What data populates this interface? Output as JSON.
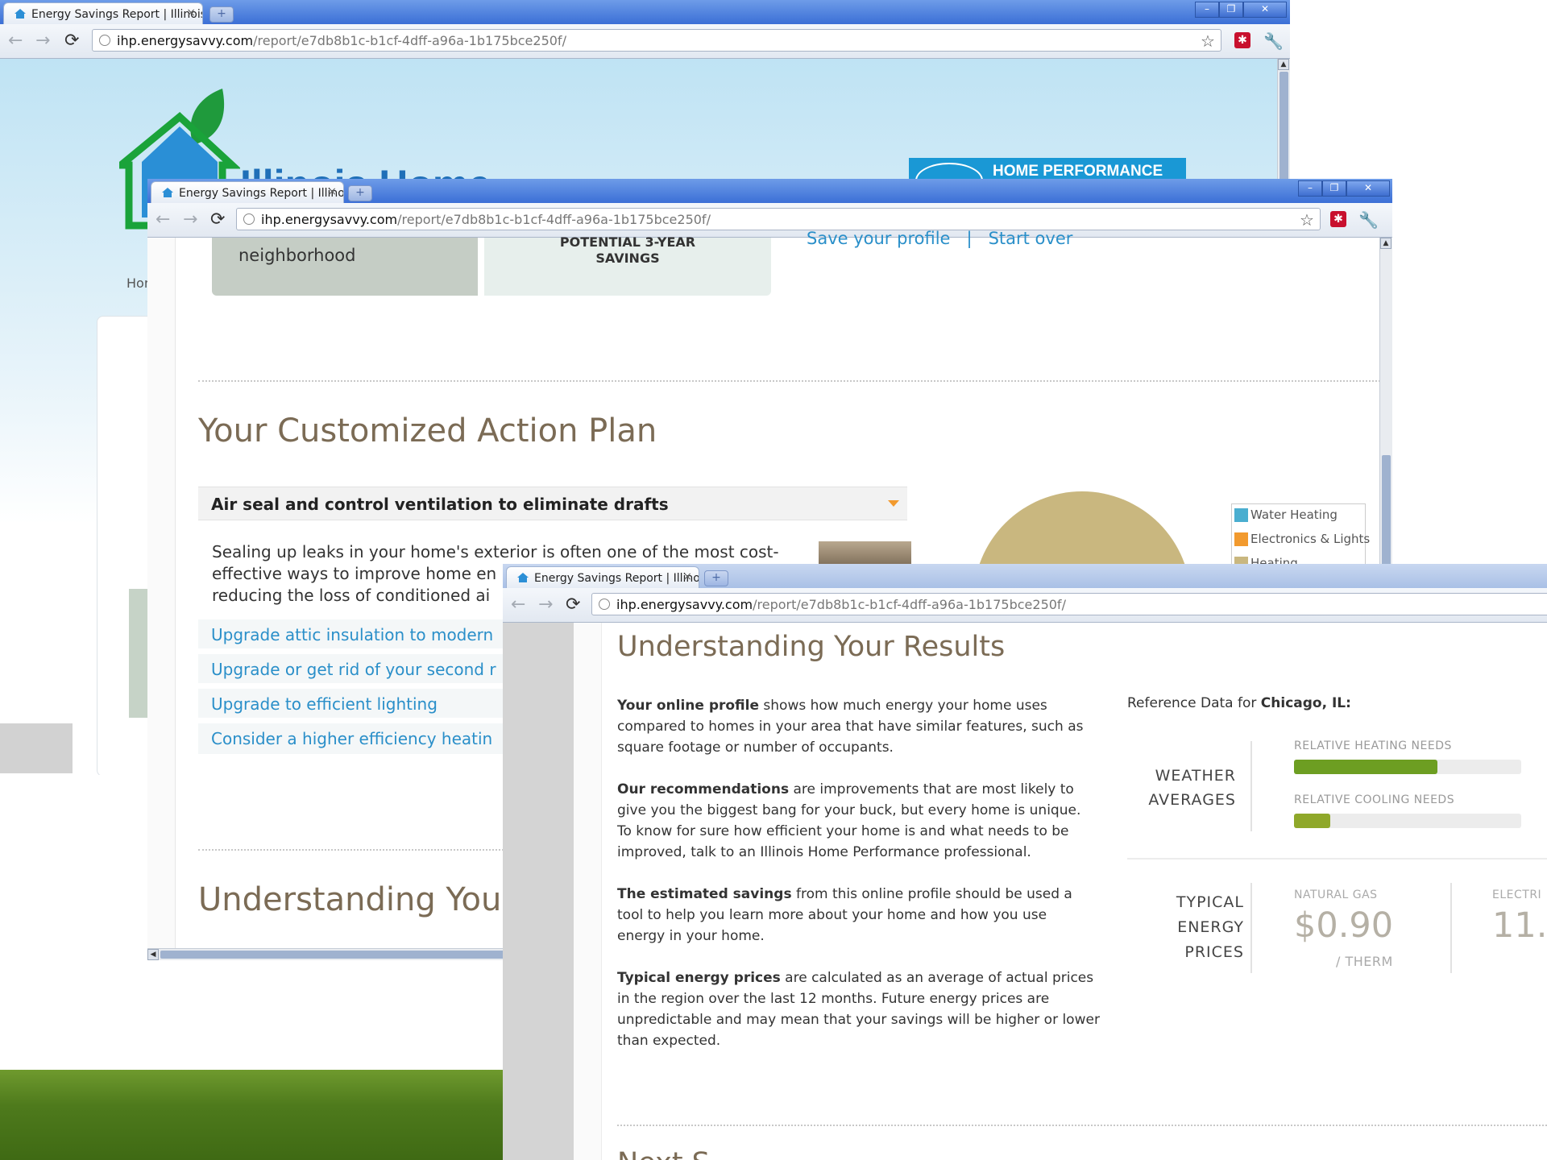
{
  "tab_title": "Energy Savings Report | Illinois",
  "url_domain": "ihp.energysavvy.com",
  "url_path": "/report/e7db8b1c-b1cf-4dff-a96a-1b175bce250f/",
  "new_tab_label": "+",
  "tab_close": "×",
  "window_buttons": {
    "minimize": "–",
    "restore": "❐",
    "close": "✕"
  },
  "nav": {
    "back": "←",
    "forward": "→",
    "reload": "C",
    "star": "☆",
    "wrench": "🔧",
    "ext": "✱"
  },
  "back_window": {
    "logo_text": "Illinois Home",
    "badge_text": "HOME PERFORMANCE WITH",
    "nav_fragment": "Hor"
  },
  "middle_window": {
    "neighborhood_label": "neighborhood",
    "savings_label_line1": "POTENTIAL 3-YEAR",
    "savings_label_line2": "SAVINGS",
    "top_links": "Save your profile   |   Start over",
    "action_plan_title": "Your Customized Action Plan",
    "recommendation_title": "Air seal and control ventilation to eliminate drafts",
    "recommendation_body": "Sealing up leaks in your home's exterior is often one of the most cost-effective ways to improve home en reducing the loss of conditioned ai",
    "body_line1": "Sealing up leaks in your home's exterior is often one of the most cost-",
    "body_line2": "effective ways to improve home en",
    "body_line3": "reducing the loss of conditioned ai",
    "links": [
      "Upgrade attic insulation to modern",
      "Upgrade or get rid of your second r",
      "Upgrade to efficient lighting",
      "Consider a higher efficiency heatin"
    ],
    "understanding_partial": "Understanding Your",
    "legend": [
      "Water Heating",
      "Electronics & Lights",
      "Heating"
    ],
    "legend_colors": [
      "#4aaed0",
      "#f29a2e",
      "#c9b77f"
    ],
    "pie_color": "#c9b77f"
  },
  "front_window": {
    "heading": "Understanding Your Results",
    "paragraphs": [
      {
        "bold": "Your online profile",
        "rest1": " shows how much energy your home uses",
        "rest2": "compared to homes in your area that have similar features, such as",
        "rest3": "square footage or number of occupants."
      },
      {
        "bold": "Our recommendations",
        "rest1": " are improvements that are most likely to",
        "rest2": "give you the biggest bang for your buck, but every home is unique.",
        "rest3": "To know for sure how efficient your home is and what needs to be",
        "rest4": "improved, talk to an Illinois Home Performance professional."
      },
      {
        "bold": "The estimated savings",
        "rest1": " from this online profile should be used a",
        "rest2": "tool to help you learn more about your home and how you use",
        "rest3": "energy in your home."
      },
      {
        "bold": "Typical energy prices",
        "rest1": " are calculated as an average of actual prices",
        "rest2": "in the region over the last 12 months. Future energy prices are",
        "rest3": "unpredictable and may mean that your savings will be higher or lower",
        "rest4": "than expected."
      }
    ],
    "reference_prefix": "Reference Data for ",
    "reference_city": "Chicago, IL:",
    "weather_label_1": "WEATHER",
    "weather_label_2": "AVERAGES",
    "heating_label": "RELATIVE HEATING NEEDS",
    "heating_level": 0.63,
    "cooling_label": "RELATIVE COOLING NEEDS",
    "cooling_level": 0.16,
    "prices_label_1": "TYPICAL",
    "prices_label_2": "ENERGY",
    "prices_label_3": "PRICES",
    "gas_label": "NATURAL GAS",
    "gas_price": "$0.90",
    "gas_unit": "/ THERM",
    "elec_label": "ELECTRI",
    "elec_price": "11.",
    "next_fragment": "Next S"
  },
  "colors": {
    "heading_brown": "#7b6b55",
    "link_blue": "#2a8fc9",
    "bar_green": "#7ea82a",
    "price_gray": "#b5b0a5"
  }
}
